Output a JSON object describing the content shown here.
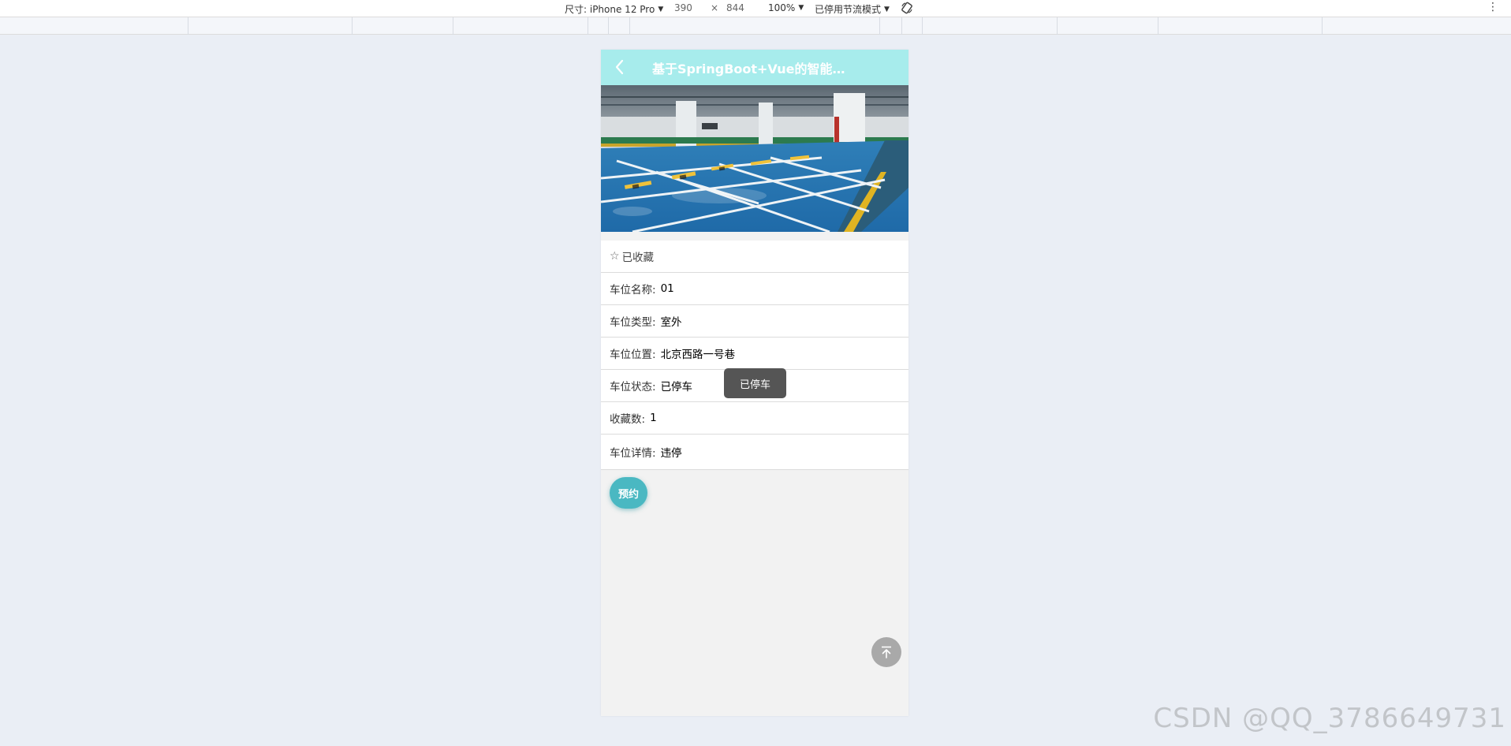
{
  "devtools": {
    "dimensions_label": "尺寸: iPhone 12 Pro",
    "width": "390",
    "times": "×",
    "height": "844",
    "zoom": "100%",
    "throttle": "已停用节流模式"
  },
  "nav": {
    "title": "基于SpringBoot+Vue的智能停..."
  },
  "detail": {
    "favorite_label": "已收藏",
    "rows": [
      {
        "label": "车位名称:",
        "value": "01"
      },
      {
        "label": "车位类型:",
        "value": "室外"
      },
      {
        "label": "车位位置:",
        "value": "北京西路一号巷"
      },
      {
        "label": "车位状态:",
        "value": "已停车"
      },
      {
        "label": "收藏数:",
        "value": "1"
      },
      {
        "label": "车位详情:",
        "value": "违停"
      }
    ]
  },
  "actions": {
    "reserve_label": "预约"
  },
  "toast": {
    "text": "已停车"
  },
  "watermark": "CSDN @QQ_3786649731",
  "colors": {
    "navbar": "#a7ecec",
    "reserve_button": "#4ab8c2",
    "toast": "#555555",
    "page_background": "#eaeef5"
  }
}
